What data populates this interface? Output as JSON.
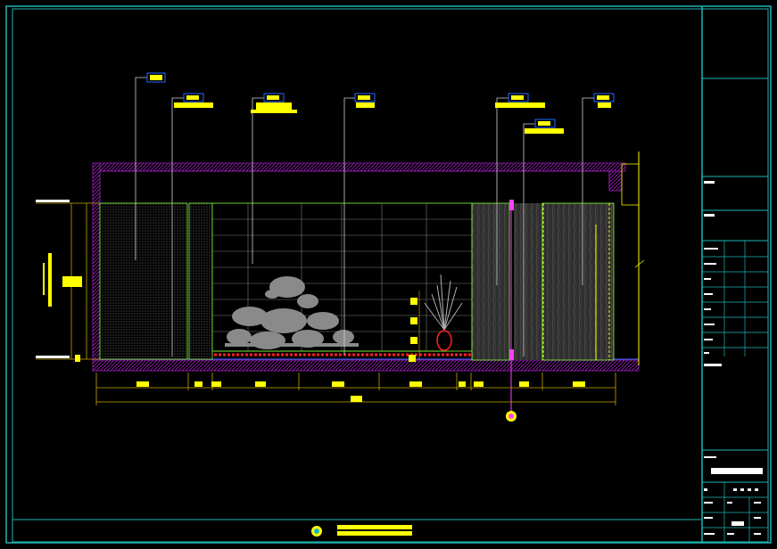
{
  "drawing": {
    "title_block_rows": [
      "",
      "",
      "",
      "",
      "",
      "",
      "",
      "",
      ""
    ],
    "sheet_label": "",
    "dimension_total": "",
    "section_marker": ""
  },
  "colors": {
    "frame": "#1fb5b5",
    "wall_hatch": "#a020c0",
    "leader": "#cfcfcf",
    "tag": "#ffff00",
    "green": "#7cff3a",
    "red": "#ff2020",
    "magenta": "#ff40ff",
    "gray_fill": "#7a7a7a",
    "dim_yellow": "#c8a400"
  },
  "tags": [
    {
      "id": "tag-1"
    },
    {
      "id": "tag-2"
    },
    {
      "id": "tag-3"
    },
    {
      "id": "tag-4"
    },
    {
      "id": "tag-5"
    },
    {
      "id": "tag-6"
    },
    {
      "id": "tag-7"
    }
  ]
}
